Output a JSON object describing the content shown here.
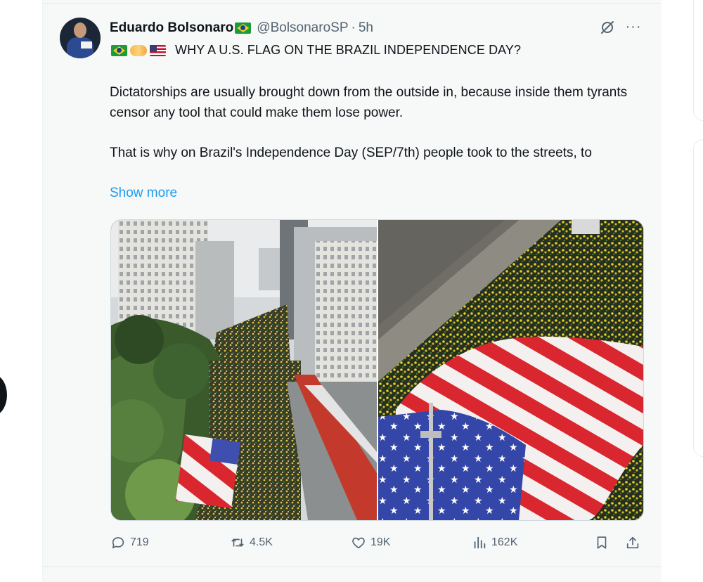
{
  "tweet": {
    "author_name": "Eduardo Bolsonaro",
    "handle": "@BolsonaroSP",
    "separator": "·",
    "time": "5h",
    "more_label": "···",
    "headline": "WHY A U.S. FLAG ON THE BRAZIL INDEPENDENCE DAY?",
    "paragraph_1": "Dictatorships are usually brought down from the outside in, because inside them tyrants censor any tool that could make them lose power.",
    "paragraph_2": "That is why on Brazil's Independence Day (SEP/7th) people took to the streets, to",
    "show_more": "Show more"
  },
  "metrics": {
    "replies": "719",
    "reposts": "4.5K",
    "likes": "19K",
    "views": "162K"
  },
  "icons": {
    "avatar": "avatar",
    "brazil_flag": "brazil-flag-icon",
    "handshake": "handshake-icon",
    "usa_flag": "usa-flag-icon",
    "grok": "grok-icon",
    "more": "more-icon",
    "reply": "reply-icon",
    "repost": "repost-icon",
    "like": "heart-icon",
    "views": "views-icon",
    "bookmark": "bookmark-icon",
    "share": "share-icon"
  },
  "colors": {
    "accent": "#1d9bf0",
    "text": "#0f1419",
    "muted": "#536471"
  }
}
